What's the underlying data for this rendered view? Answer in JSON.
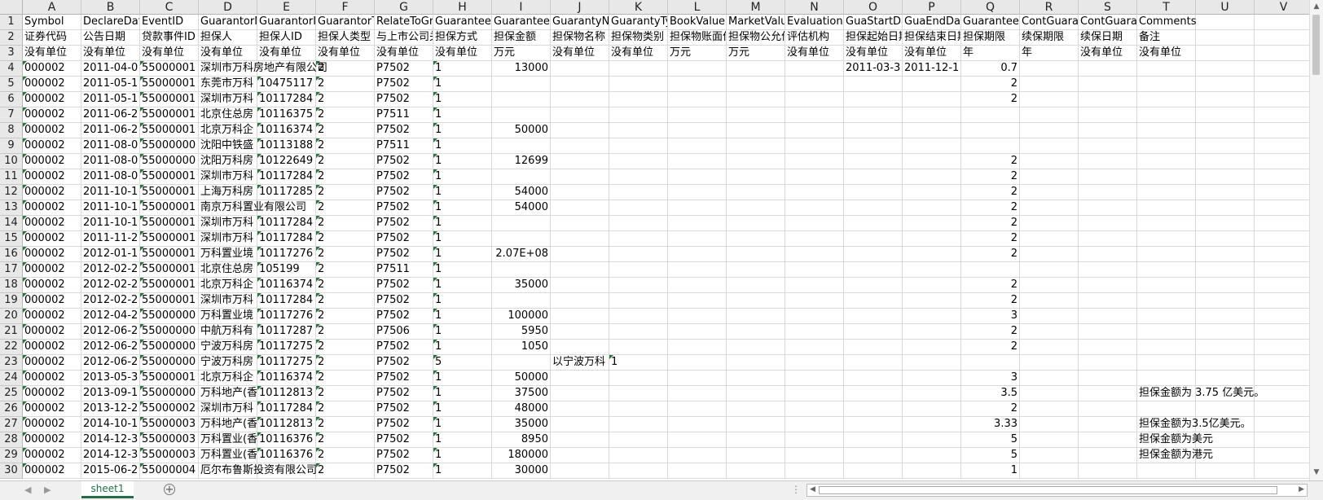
{
  "columns": [
    "A",
    "B",
    "C",
    "D",
    "E",
    "F",
    "G",
    "H",
    "I",
    "J",
    "K",
    "L",
    "M",
    "N",
    "O",
    "P",
    "Q",
    "R",
    "S",
    "T",
    "U",
    "V"
  ],
  "rows": [
    [
      "Symbol",
      "DeclareDate",
      "EventID",
      "GuarantorName",
      "GuarantorID",
      "GuarantorType",
      "RelateToGroup",
      "GuaranteeType",
      "GuaranteeAmount",
      "GuarantyName",
      "GuarantyType",
      "BookValue",
      "MarketValue",
      "EvaluationAgency",
      "GuaStartDate",
      "GuaEndDate",
      "GuaranteeTerm",
      "ContGuaranteeTerm",
      "ContGuaranteeDate",
      "Comments"
    ],
    [
      "证券代码",
      "公告日期",
      "贷款事件ID",
      "担保人",
      "担保人ID",
      "担保人类型",
      "与上市公司关系",
      "担保方式",
      "担保金额",
      "担保物名称",
      "担保物类别",
      "担保物账面价值",
      "担保物公允价值",
      "评估机构",
      "担保起始日期",
      "担保结束日期",
      "担保期限",
      "续保期限",
      "续保日期",
      "备注"
    ],
    [
      "没有单位",
      "没有单位",
      "没有单位",
      "没有单位",
      "没有单位",
      "没有单位",
      "没有单位",
      "没有单位",
      "万元",
      "没有单位",
      "没有单位",
      "万元",
      "万元",
      "没有单位",
      "没有单位",
      "没有单位",
      "年",
      "年",
      "没有单位",
      "没有单位"
    ],
    [
      "000002",
      "2011-04-0",
      "55000001",
      "深圳市万科房地产有限公司",
      "",
      "2",
      "P7502",
      "1",
      "13000",
      "",
      "",
      "",
      "",
      "",
      "2011-03-3",
      "2011-12-1",
      "0.7",
      "",
      "",
      ""
    ],
    [
      "000002",
      "2011-05-1",
      "55000001",
      "东莞市万科",
      "10475117",
      "2",
      "P7502",
      "1",
      "",
      "",
      "",
      "",
      "",
      "",
      "",
      "",
      "2",
      "",
      "",
      ""
    ],
    [
      "000002",
      "2011-05-1",
      "55000001",
      "深圳市万科",
      "10117284",
      "2",
      "P7502",
      "1",
      "",
      "",
      "",
      "",
      "",
      "",
      "",
      "",
      "2",
      "",
      "",
      ""
    ],
    [
      "000002",
      "2011-06-2",
      "55000001",
      "北京住总房",
      "10116375",
      "2",
      "P7511",
      "1",
      "",
      "",
      "",
      "",
      "",
      "",
      "",
      "",
      "",
      "",
      "",
      ""
    ],
    [
      "000002",
      "2011-06-2",
      "55000001",
      "北京万科企",
      "10116374",
      "2",
      "P7502",
      "1",
      "50000",
      "",
      "",
      "",
      "",
      "",
      "",
      "",
      "",
      "",
      "",
      ""
    ],
    [
      "000002",
      "2011-08-0",
      "55000000",
      "沈阳中铁盛",
      "10113188",
      "2",
      "P7511",
      "1",
      "",
      "",
      "",
      "",
      "",
      "",
      "",
      "",
      "",
      "",
      "",
      ""
    ],
    [
      "000002",
      "2011-08-0",
      "55000000",
      "沈阳万科房",
      "10122649",
      "2",
      "P7502",
      "1",
      "12699",
      "",
      "",
      "",
      "",
      "",
      "",
      "",
      "2",
      "",
      "",
      ""
    ],
    [
      "000002",
      "2011-08-0",
      "55000001",
      "深圳市万科",
      "10117284",
      "2",
      "P7502",
      "1",
      "",
      "",
      "",
      "",
      "",
      "",
      "",
      "",
      "2",
      "",
      "",
      ""
    ],
    [
      "000002",
      "2011-10-1",
      "55000001",
      "上海万科房",
      "10117285",
      "2",
      "P7502",
      "1",
      "54000",
      "",
      "",
      "",
      "",
      "",
      "",
      "",
      "2",
      "",
      "",
      ""
    ],
    [
      "000002",
      "2011-10-1",
      "55000001",
      "南京万科置业有限公司",
      "",
      "2",
      "P7502",
      "1",
      "54000",
      "",
      "",
      "",
      "",
      "",
      "",
      "",
      "2",
      "",
      "",
      ""
    ],
    [
      "000002",
      "2011-10-1",
      "55000001",
      "深圳市万科",
      "10117284",
      "2",
      "P7502",
      "1",
      "",
      "",
      "",
      "",
      "",
      "",
      "",
      "",
      "2",
      "",
      "",
      ""
    ],
    [
      "000002",
      "2011-11-2",
      "55000001",
      "深圳市万科",
      "10117284",
      "2",
      "P7502",
      "1",
      "",
      "",
      "",
      "",
      "",
      "",
      "",
      "",
      "2",
      "",
      "",
      ""
    ],
    [
      "000002",
      "2012-01-1",
      "55000001",
      "万科置业境",
      "10117276",
      "2",
      "P7502",
      "1",
      "2.07E+08",
      "",
      "",
      "",
      "",
      "",
      "",
      "",
      "2",
      "",
      "",
      ""
    ],
    [
      "000002",
      "2012-02-2",
      "55000001",
      "北京住总房",
      "105199",
      "2",
      "P7511",
      "1",
      "",
      "",
      "",
      "",
      "",
      "",
      "",
      "",
      "",
      "",
      "",
      ""
    ],
    [
      "000002",
      "2012-02-2",
      "55000001",
      "北京万科企",
      "10116374",
      "2",
      "P7502",
      "1",
      "35000",
      "",
      "",
      "",
      "",
      "",
      "",
      "",
      "2",
      "",
      "",
      ""
    ],
    [
      "000002",
      "2012-02-2",
      "55000001",
      "深圳市万科",
      "10117284",
      "2",
      "P7502",
      "1",
      "",
      "",
      "",
      "",
      "",
      "",
      "",
      "",
      "2",
      "",
      "",
      ""
    ],
    [
      "000002",
      "2012-04-2",
      "55000000",
      "万科置业境",
      "10117276",
      "2",
      "P7502",
      "1",
      "100000",
      "",
      "",
      "",
      "",
      "",
      "",
      "",
      "3",
      "",
      "",
      ""
    ],
    [
      "000002",
      "2012-06-2",
      "55000000",
      "中航万科有",
      "10117287",
      "2",
      "P7506",
      "1",
      "5950",
      "",
      "",
      "",
      "",
      "",
      "",
      "",
      "2",
      "",
      "",
      ""
    ],
    [
      "000002",
      "2012-06-2",
      "55000000",
      "宁波万科房",
      "10117275",
      "2",
      "P7502",
      "1",
      "1050",
      "",
      "",
      "",
      "",
      "",
      "",
      "",
      "2",
      "",
      "",
      ""
    ],
    [
      "000002",
      "2012-06-2",
      "55000000",
      "宁波万科房",
      "10117275",
      "2",
      "P7502",
      "5",
      "",
      "以宁波万科",
      "1",
      "",
      "",
      "",
      "",
      "",
      "",
      "",
      "",
      ""
    ],
    [
      "000002",
      "2013-05-3",
      "55000001",
      "北京万科企",
      "10116374",
      "2",
      "P7502",
      "1",
      "50000",
      "",
      "",
      "",
      "",
      "",
      "",
      "",
      "3",
      "",
      "",
      ""
    ],
    [
      "000002",
      "2013-09-1",
      "55000000",
      "万科地产(香",
      "10112813",
      "2",
      "P7502",
      "1",
      "37500",
      "",
      "",
      "",
      "",
      "",
      "",
      "",
      "3.5",
      "",
      "",
      "担保金额为 3.75 亿美元。"
    ],
    [
      "000002",
      "2013-12-2",
      "55000002",
      "深圳市万科",
      "10117284",
      "2",
      "P7502",
      "1",
      "48000",
      "",
      "",
      "",
      "",
      "",
      "",
      "",
      "2",
      "",
      "",
      ""
    ],
    [
      "000002",
      "2014-10-1",
      "55000003",
      "万科地产(香",
      "10112813",
      "2",
      "P7502",
      "1",
      "35000",
      "",
      "",
      "",
      "",
      "",
      "",
      "",
      "3.33",
      "",
      "",
      "担保金额为3.5亿美元。"
    ],
    [
      "000002",
      "2014-12-3",
      "55000003",
      "万科置业(香",
      "10116376",
      "2",
      "P7502",
      "1",
      "8950",
      "",
      "",
      "",
      "",
      "",
      "",
      "",
      "5",
      "",
      "",
      "担保金额为美元"
    ],
    [
      "000002",
      "2014-12-3",
      "55000003",
      "万科置业(香",
      "10116376",
      "2",
      "P7502",
      "1",
      "180000",
      "",
      "",
      "",
      "",
      "",
      "",
      "",
      "5",
      "",
      "",
      "担保金额为港元"
    ],
    [
      "000002",
      "2015-06-2",
      "55000004",
      "厄尔布鲁斯投资有限公司",
      "",
      "2",
      "P7502",
      "1",
      "30000",
      "",
      "",
      "",
      "",
      "",
      "",
      "",
      "1",
      "",
      "",
      ""
    ]
  ],
  "sheet_tab": "sheet1",
  "colors": {
    "accent": "#1e7145",
    "text_marker": "#1d7a34"
  }
}
